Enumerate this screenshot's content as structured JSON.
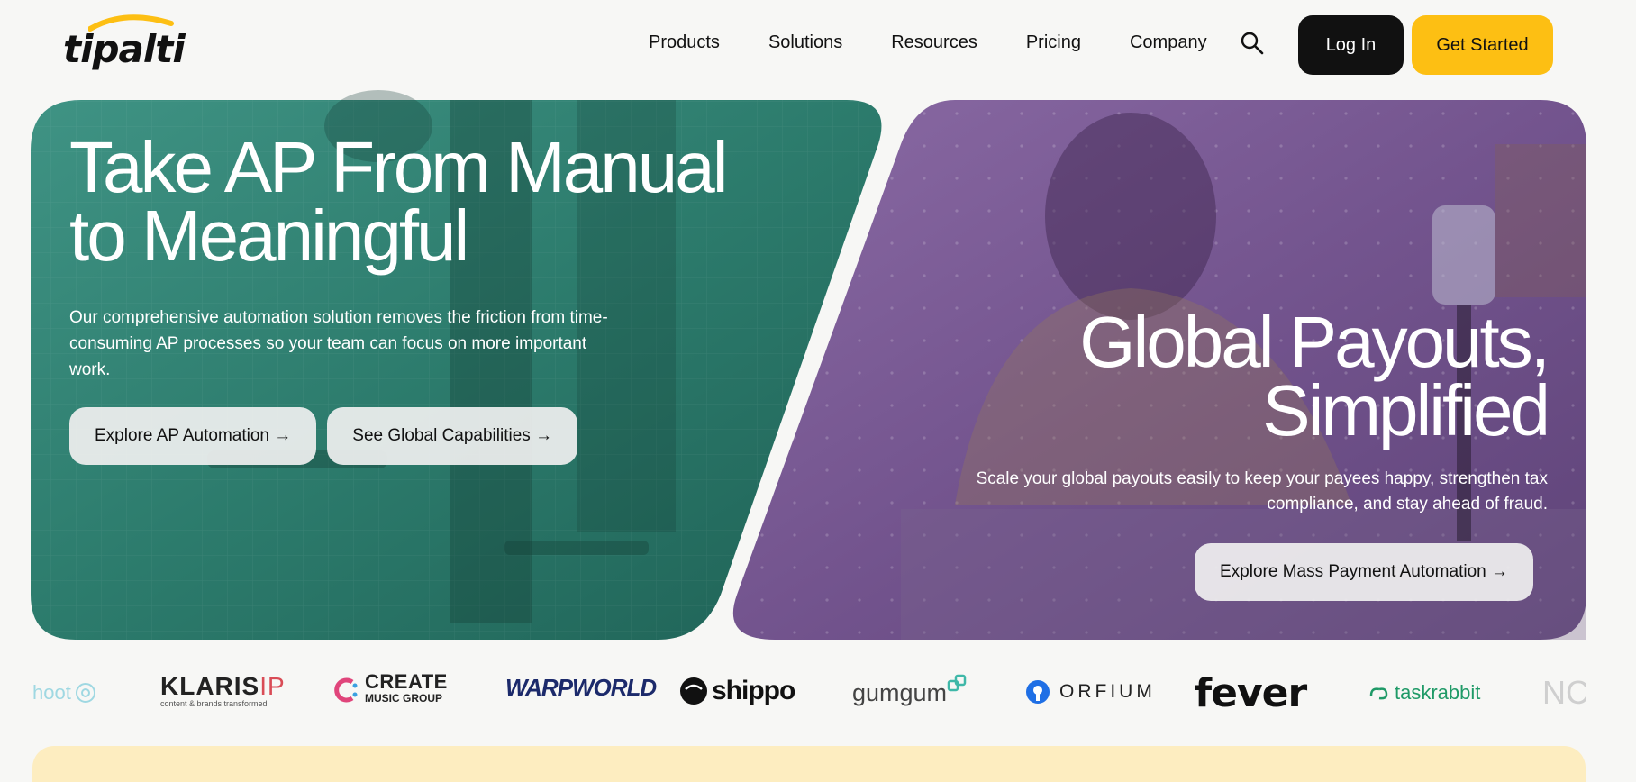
{
  "header": {
    "logo_text": "tipalti",
    "nav": [
      "Products",
      "Solutions",
      "Resources",
      "Pricing",
      "Company"
    ],
    "login_label": "Log In",
    "get_started_label": "Get Started"
  },
  "hero_left": {
    "title_line1": "Take AP From Manual",
    "title_line2": "to Meaningful",
    "description": "Our comprehensive automation solution removes the friction from time-consuming AP processes so your team can focus on more important work.",
    "button1": "Explore AP Automation →",
    "button2": "See Global Capabilities →",
    "panel_color": "#2b7a6c"
  },
  "hero_right": {
    "title_line1": "Global Payouts,",
    "title_line2": "Simplified",
    "description": "Scale your global payouts easily to keep your payees happy, strengthen tax compliance, and stay ahead of fraud.",
    "button": "Explore Mass Payment Automation →",
    "panel_color": "#7a5a94"
  },
  "logos": {
    "shoot": "hoot",
    "klaris": "KLARIS",
    "klaris_ip": "IP",
    "klaris_tagline": "content & brands transformed",
    "create_line1": "CREATE",
    "create_line2": "MUSIC GROUP",
    "warpworld": "WARPWORLD",
    "shippo": "shippo",
    "gumgum": "gumgum",
    "orfium": "ORFIUM",
    "fever": "fever",
    "taskrabbit": "taskrabbit",
    "partial": "NC"
  },
  "colors": {
    "accent_yellow": "#fdbf13",
    "login_dark": "#111111"
  }
}
